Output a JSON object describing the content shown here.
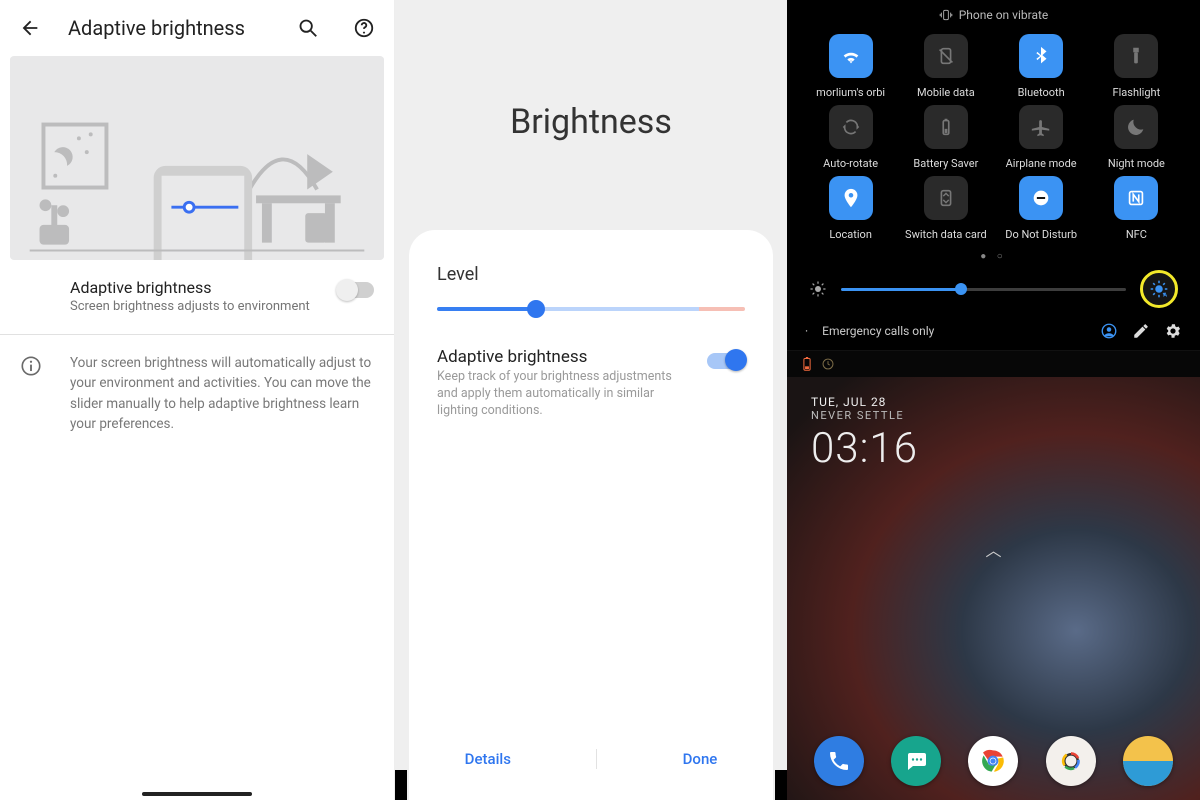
{
  "pane1": {
    "title": "Adaptive brightness",
    "setting": {
      "label": "Adaptive brightness",
      "subtitle": "Screen brightness adjusts to environment",
      "enabled": false
    },
    "info_text": "Your screen brightness will automatically adjust to your environment and activities. You can move the slider manually to help adaptive brightness learn your preferences."
  },
  "pane2": {
    "title": "Brightness",
    "level_label": "Level",
    "level_percent": 32,
    "adaptive": {
      "label": "Adaptive brightness",
      "subtitle": "Keep track of your brightness adjustments and apply them automatically in similar lighting conditions.",
      "enabled": true
    },
    "actions": {
      "details": "Details",
      "done": "Done"
    }
  },
  "pane3": {
    "status_text": "Phone on vibrate",
    "tiles": [
      {
        "label": "morlium's orbi",
        "icon": "wifi",
        "on": true
      },
      {
        "label": "Mobile data",
        "icon": "sim-off",
        "on": false
      },
      {
        "label": "Bluetooth",
        "icon": "bluetooth",
        "on": true
      },
      {
        "label": "Flashlight",
        "icon": "flashlight",
        "on": false
      },
      {
        "label": "Auto-rotate",
        "icon": "rotate",
        "on": false
      },
      {
        "label": "Battery Saver",
        "icon": "battery",
        "on": false
      },
      {
        "label": "Airplane mode",
        "icon": "airplane",
        "on": false
      },
      {
        "label": "Night mode",
        "icon": "moon",
        "on": false
      },
      {
        "label": "Location",
        "icon": "location",
        "on": true
      },
      {
        "label": "Switch data card",
        "icon": "sim-switch",
        "on": false
      },
      {
        "label": "Do Not Disturb",
        "icon": "dnd",
        "on": true
      },
      {
        "label": "NFC",
        "icon": "nfc",
        "on": true
      }
    ],
    "brightness_percent": 42,
    "footer_label": "Emergency calls only",
    "home": {
      "date": "TUE, JUL 28",
      "tagline": "NEVER SETTLE",
      "time": "03:16"
    }
  }
}
